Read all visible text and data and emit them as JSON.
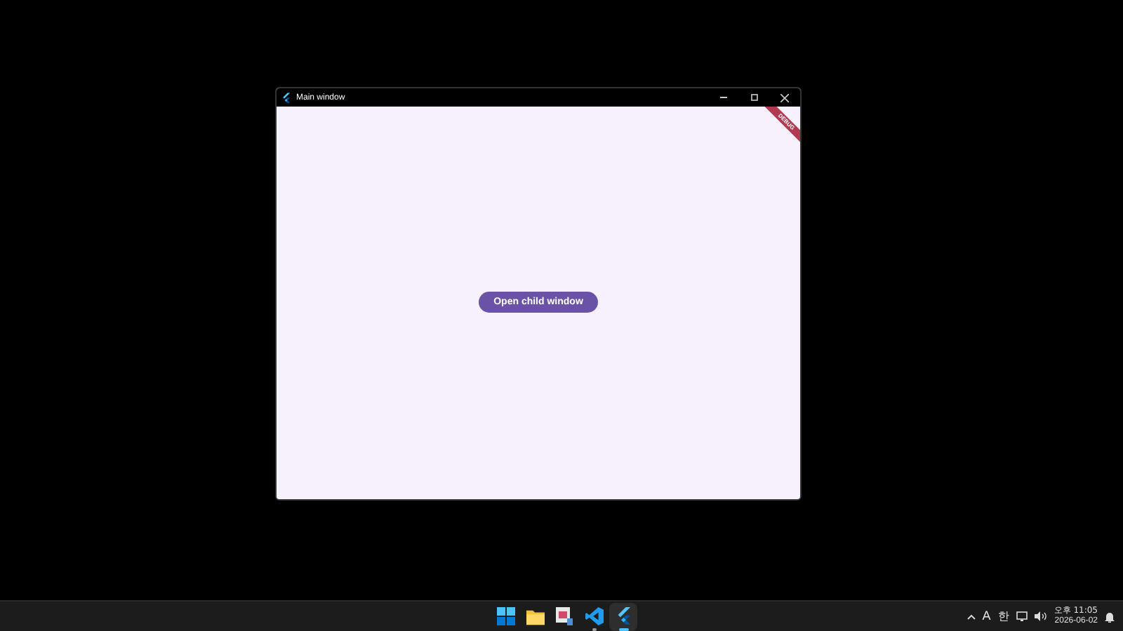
{
  "window": {
    "title": "Main window"
  },
  "debug_banner": "DEBUG",
  "button": {
    "label": "Open child window"
  },
  "taskbar": {
    "apps": [
      {
        "kind": "start"
      },
      {
        "kind": "folder"
      },
      {
        "kind": "app"
      },
      {
        "kind": "code",
        "running": true
      },
      {
        "kind": "flutter",
        "running": true
      }
    ],
    "tray": {
      "ime": "A",
      "lang": "한",
      "time": "오후 11:05",
      "date": "2026-06-02"
    }
  }
}
